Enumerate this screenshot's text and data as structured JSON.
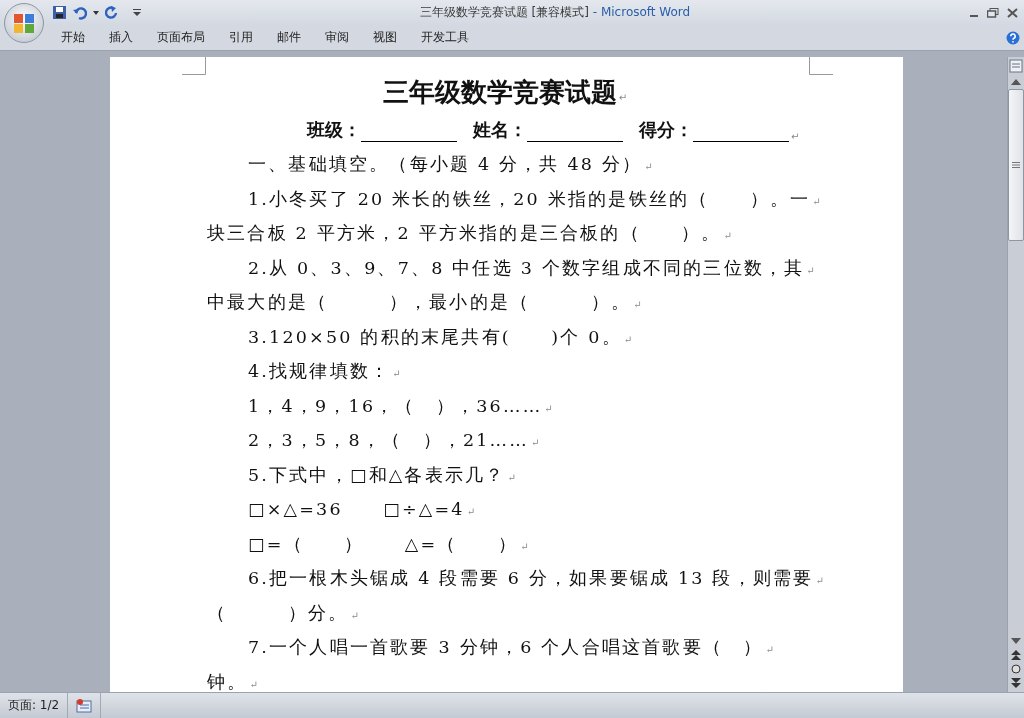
{
  "window": {
    "title": "三年级数学竞赛试题 [兼容模式]",
    "app": " - Microsoft Word"
  },
  "ribbon_tabs": [
    {
      "label": "开始"
    },
    {
      "label": "插入"
    },
    {
      "label": "页面布局"
    },
    {
      "label": "引用"
    },
    {
      "label": "邮件"
    },
    {
      "label": "审阅"
    },
    {
      "label": "视图"
    },
    {
      "label": "开发工具"
    }
  ],
  "document": {
    "title": "三年级数学竞赛试题",
    "mark": "↵",
    "header_fields": [
      {
        "label": "班级："
      },
      {
        "label": "姓名："
      },
      {
        "label": "得分："
      }
    ],
    "lines": [
      {
        "text": "一、基础填空。（每小题 4 分，共 48 分）",
        "kind": "first"
      },
      {
        "text": "1.小冬买了 20 米长的铁丝，20 米指的是铁丝的（　　）。一",
        "kind": "first"
      },
      {
        "text": "块三合板 2 平方米，2 平方米指的是三合板的（　　）。",
        "kind": "wrap"
      },
      {
        "text": "2.从 0、3、9、7、8 中任选 3 个数字组成不同的三位数，其",
        "kind": "first"
      },
      {
        "text": "中最大的是（　　　），最小的是（　　　）。",
        "kind": "wrap"
      },
      {
        "text": "3.120×50 的积的末尾共有(　　)个 0。",
        "kind": "first"
      },
      {
        "text": "4.找规律填数：",
        "kind": "first"
      },
      {
        "text": "1，4，9，16，（　），36……",
        "kind": "first"
      },
      {
        "text": "2，3，5，8，（　），21……",
        "kind": "first"
      },
      {
        "text": "5.下式中，□和△各表示几？",
        "kind": "first"
      },
      {
        "text": "□×△=36　　□÷△=4",
        "kind": "first"
      },
      {
        "text": "□=（　　）　　△=（　　）",
        "kind": "first"
      },
      {
        "text": "6.把一根木头锯成 4 段需要 6 分，如果要锯成 13 段，则需要",
        "kind": "first"
      },
      {
        "text": "（　　　）分。",
        "kind": "wrap"
      },
      {
        "text": "7.一个人唱一首歌要 3 分钟，6 个人合唱这首歌要（　）",
        "kind": "first"
      },
      {
        "text": "钟。",
        "kind": "wrap"
      }
    ]
  },
  "status_bar": {
    "page": "页面: 1/2"
  }
}
